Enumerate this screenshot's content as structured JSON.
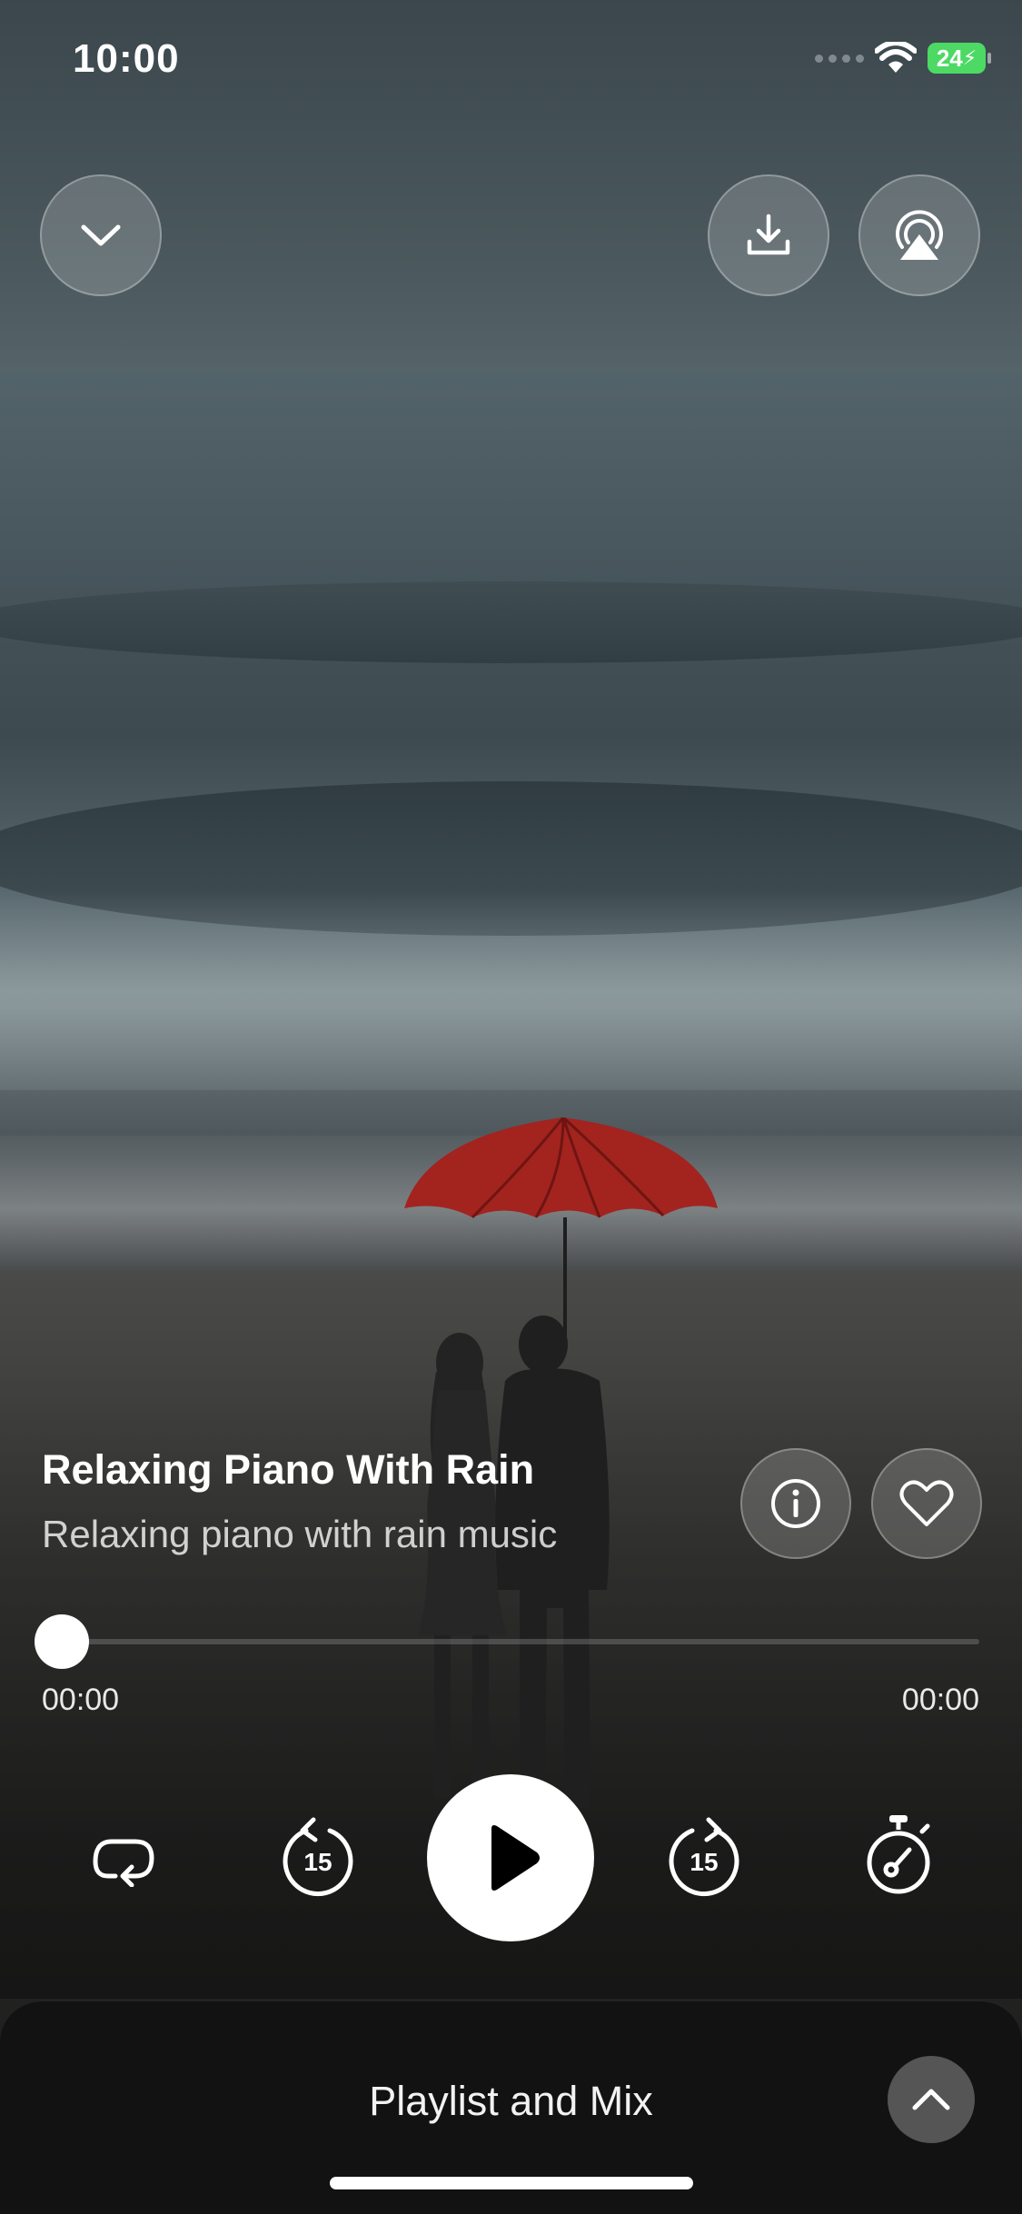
{
  "status": {
    "time": "10:00",
    "battery": "24"
  },
  "track": {
    "title": "Relaxing Piano With Rain",
    "subtitle": "Relaxing piano with rain music"
  },
  "playback": {
    "elapsed": "00:00",
    "duration": "00:00",
    "progress_fraction": 0,
    "skip_back_seconds": "15",
    "skip_forward_seconds": "15"
  },
  "sheet": {
    "title": "Playlist and Mix"
  },
  "colors": {
    "accent": "#ffffff",
    "battery": "#4cd964",
    "umbrella": "#a3231f"
  }
}
